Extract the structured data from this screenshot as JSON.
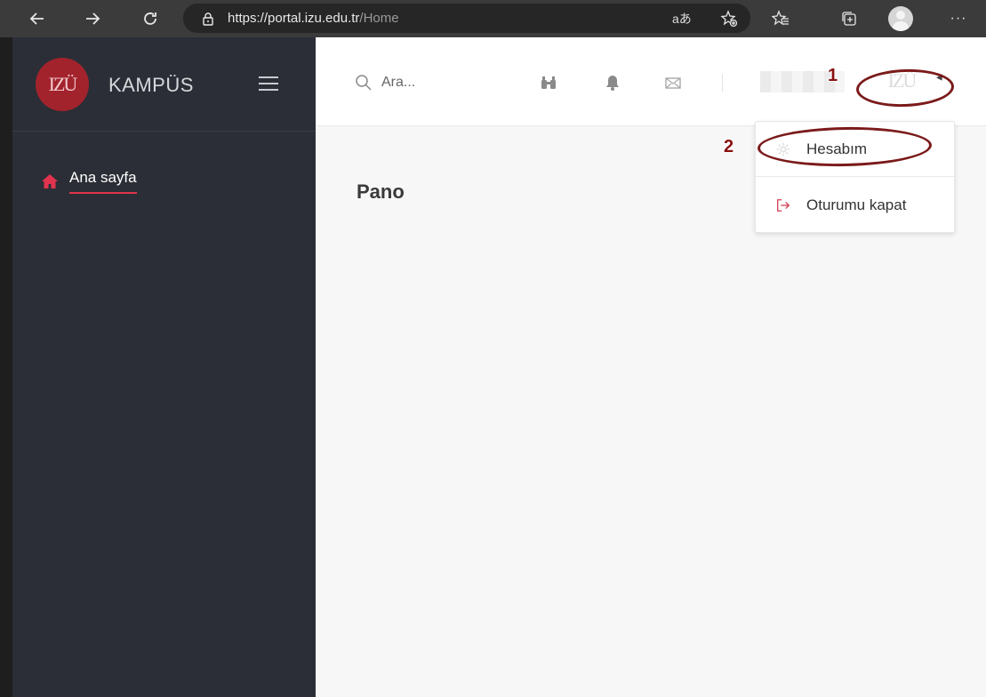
{
  "browser": {
    "url_main": "https://portal.izu.edu.tr",
    "url_path": "/Home"
  },
  "sidebar": {
    "logo_text": "IZÜ",
    "brand": "KAMPÜS",
    "items": [
      {
        "label": "Ana sayfa",
        "icon": "home-icon",
        "active": true
      }
    ]
  },
  "header": {
    "search_placeholder": "Ara...",
    "avatar_text": "IZÜ"
  },
  "main": {
    "title": "Pano"
  },
  "dropdown": {
    "items": [
      {
        "label": "Hesabım",
        "icon": "gear-icon"
      },
      {
        "label": "Oturumu kapat",
        "icon": "logout-icon"
      }
    ]
  },
  "annotations": [
    {
      "number": "1"
    },
    {
      "number": "2"
    }
  ],
  "colors": {
    "accent": "#e0344e",
    "logo_bg": "#a3232c",
    "sidebar_bg": "#2b2e36",
    "annotation": "#7b1a1a"
  }
}
